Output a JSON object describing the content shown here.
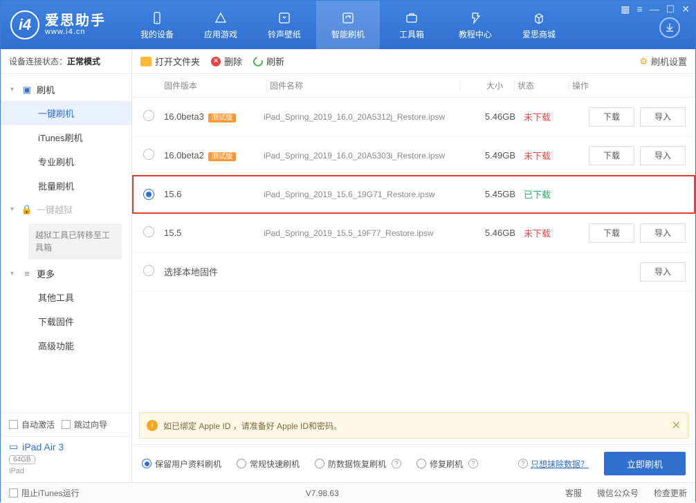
{
  "app": {
    "name": "爱思助手",
    "url": "www.i4.cn"
  },
  "titlebar_icons": [
    "grid",
    "menu",
    "min",
    "max",
    "close"
  ],
  "nav": [
    {
      "label": "我的设备"
    },
    {
      "label": "应用游戏"
    },
    {
      "label": "铃声壁纸"
    },
    {
      "label": "智能刷机",
      "active": true
    },
    {
      "label": "工具箱"
    },
    {
      "label": "教程中心"
    },
    {
      "label": "爱思商城"
    }
  ],
  "connection": {
    "prefix": "设备连接状态：",
    "mode": "正常模式"
  },
  "tree": {
    "flash": {
      "label": "刷机",
      "children": [
        {
          "label": "一键刷机",
          "active": true
        },
        {
          "label": "iTunes刷机"
        },
        {
          "label": "专业刷机"
        },
        {
          "label": "批量刷机"
        }
      ]
    },
    "jailbreak": {
      "label": "一键越狱",
      "note": "越狱工具已转移至工具箱"
    },
    "more": {
      "label": "更多",
      "children": [
        {
          "label": "其他工具"
        },
        {
          "label": "下载固件"
        },
        {
          "label": "高级功能"
        }
      ]
    }
  },
  "sidebar_checks": {
    "auto_activate": "自动激活",
    "skip_guide": "跳过向导"
  },
  "device": {
    "name": "iPad Air 3",
    "capacity": "64GB",
    "type": "iPad"
  },
  "toolbar": {
    "open": "打开文件夹",
    "del": "删除",
    "refresh": "刷新",
    "settings": "刷机设置"
  },
  "columns": {
    "version": "固件版本",
    "name": "固件名称",
    "size": "大小",
    "status": "状态",
    "ops": "操作"
  },
  "ops": {
    "download": "下载",
    "import": "导入"
  },
  "status": {
    "not": "未下载",
    "done": "已下载"
  },
  "rows": [
    {
      "version": "16.0beta3",
      "beta": "测试版",
      "file": "iPad_Spring_2019_16.0_20A5312j_Restore.ipsw",
      "size": "5.46GB",
      "status": "not"
    },
    {
      "version": "16.0beta2",
      "beta": "测试版",
      "file": "iPad_Spring_2019_16.0_20A5303i_Restore.ipsw",
      "size": "5.49GB",
      "status": "not"
    },
    {
      "version": "15.6",
      "file": "iPad_Spring_2019_15.6_19G71_Restore.ipsw",
      "size": "5.45GB",
      "status": "done",
      "selected": true,
      "highlight": true
    },
    {
      "version": "15.5",
      "file": "iPad_Spring_2019_15.5_19F77_Restore.ipsw",
      "size": "5.46GB",
      "status": "not"
    }
  ],
  "local_row": {
    "label": "选择本地固件"
  },
  "alert": "如已绑定 Apple ID ，请准备好 Apple ID和密码。",
  "options": {
    "o1": "保留用户资料刷机",
    "o2": "常规快速刷机",
    "o3": "防数据恢复刷机",
    "o4": "修复刷机",
    "erase": "只想抹除数据？",
    "flash": "立即刷机"
  },
  "footer": {
    "block_itunes": "阻止iTunes运行",
    "version": "V7.98.63",
    "links": [
      "客服",
      "微信公众号",
      "检查更新"
    ]
  }
}
